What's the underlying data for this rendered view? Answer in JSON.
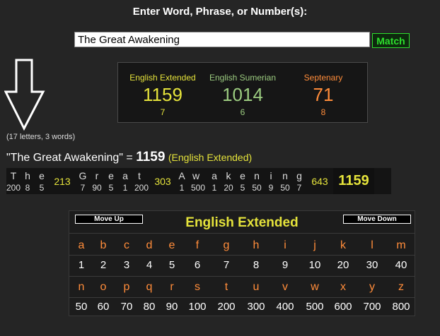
{
  "header": {
    "prompt": "Enter Word, Phrase, or Number(s):"
  },
  "search": {
    "value": "The Great Awakening",
    "match_label": "Match"
  },
  "results": [
    {
      "name": "English Extended",
      "total": "1159",
      "reduced": "7",
      "color": "#e5e33b"
    },
    {
      "name": "English Sumerian",
      "total": "1014",
      "reduced": "6",
      "color": "#9ccc80"
    },
    {
      "name": "Septenary",
      "total": "71",
      "reduced": "8",
      "color": "#ff8c3a"
    }
  ],
  "arrow_icon": "down-arrow-icon",
  "letter_count": "(17 letters, 3 words)",
  "phrase": {
    "quoted": "\"The Great Awakening\"",
    "equals": "=",
    "total": "1159",
    "cipher": "(English Extended)"
  },
  "breakdown": {
    "words": [
      {
        "letters": [
          {
            "l": "T",
            "v": "200"
          },
          {
            "l": "h",
            "v": "8"
          },
          {
            "l": "e",
            "v": "5"
          }
        ],
        "sum": "213"
      },
      {
        "letters": [
          {
            "l": "G",
            "v": "7"
          },
          {
            "l": "r",
            "v": "90"
          },
          {
            "l": "e",
            "v": "5"
          },
          {
            "l": "a",
            "v": "1"
          },
          {
            "l": "t",
            "v": "200"
          }
        ],
        "sum": "303"
      },
      {
        "letters": [
          {
            "l": "A",
            "v": "1"
          },
          {
            "l": "w",
            "v": "500"
          },
          {
            "l": "a",
            "v": "1"
          },
          {
            "l": "k",
            "v": "20"
          },
          {
            "l": "e",
            "v": "5"
          },
          {
            "l": "n",
            "v": "50"
          },
          {
            "l": "i",
            "v": "9"
          },
          {
            "l": "n",
            "v": "50"
          },
          {
            "l": "g",
            "v": "7"
          }
        ],
        "sum": "643"
      }
    ],
    "total": "1159"
  },
  "cipher_table": {
    "title": "English Extended",
    "move_up": "Move Up",
    "move_down": "Move Down",
    "row1_letters": [
      "a",
      "b",
      "c",
      "d",
      "e",
      "f",
      "g",
      "h",
      "i",
      "j",
      "k",
      "l",
      "m"
    ],
    "row1_values": [
      "1",
      "2",
      "3",
      "4",
      "5",
      "6",
      "7",
      "8",
      "9",
      "10",
      "20",
      "30",
      "40"
    ],
    "row2_letters": [
      "n",
      "o",
      "p",
      "q",
      "r",
      "s",
      "t",
      "u",
      "v",
      "w",
      "x",
      "y",
      "z"
    ],
    "row2_values": [
      "50",
      "60",
      "70",
      "80",
      "90",
      "100",
      "200",
      "300",
      "400",
      "500",
      "600",
      "700",
      "800"
    ]
  }
}
